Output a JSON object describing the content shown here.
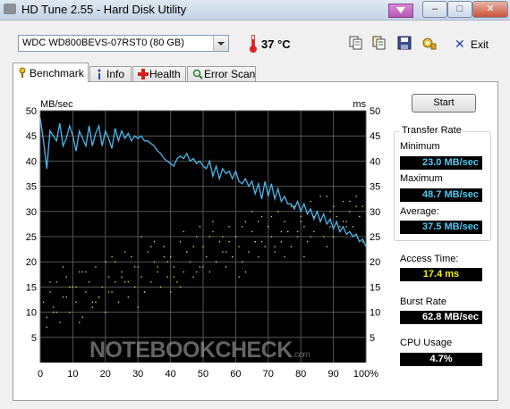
{
  "window": {
    "title": "HD Tune 2.55 - Hard Disk Utility",
    "minimize_glyph": "–",
    "maximize_glyph": "□",
    "close_glyph": "✕"
  },
  "toolbar": {
    "drive": "WDC WD800BEVS-07RST0 (80 GB)",
    "temperature": "37 °C",
    "exit_label": "Exit",
    "buttons": [
      "copy-icon",
      "copy-text-icon",
      "save-icon",
      "options-icon"
    ]
  },
  "tabs": [
    {
      "label": "Benchmark",
      "icon": "benchmark-icon",
      "active": true
    },
    {
      "label": "Info",
      "icon": "info-icon",
      "active": false
    },
    {
      "label": "Health",
      "icon": "health-icon",
      "active": false
    },
    {
      "label": "Error Scan",
      "icon": "error-scan-icon",
      "active": false
    }
  ],
  "benchmark": {
    "start_label": "Start",
    "transfer_rate_title": "Transfer Rate",
    "minimum_label": "Minimum",
    "minimum_value": "23.0 MB/sec",
    "maximum_label": "Maximum",
    "maximum_value": "48.7 MB/sec",
    "average_label": "Average:",
    "average_value": "37.5 MB/sec",
    "access_time_label": "Access Time:",
    "access_time_value": "17.4 ms",
    "burst_rate_label": "Burst Rate",
    "burst_rate_value": "62.8 MB/sec",
    "cpu_usage_label": "CPU Usage",
    "cpu_usage_value": "4.7%"
  },
  "watermark": {
    "text": "NOTEBOOKCHECK",
    "suffix": ".com"
  },
  "colors": {
    "transfer_line": "#4ab8ef",
    "access_points": "#e8e84a",
    "grid": "#555555",
    "plot_bg": "#000000"
  },
  "chart_data": {
    "type": "line",
    "xlabel": "",
    "ylabel_left": "MB/sec",
    "ylabel_right": "ms",
    "xlim": [
      0,
      100
    ],
    "ylim_left": [
      0,
      50
    ],
    "ylim_right": [
      0,
      50
    ],
    "x_ticks": [
      "0",
      "10",
      "20",
      "30",
      "40",
      "50",
      "60",
      "70",
      "80",
      "90",
      "100%"
    ],
    "y_ticks": [
      "5",
      "10",
      "15",
      "20",
      "25",
      "30",
      "35",
      "40",
      "45",
      "50"
    ],
    "grid": true,
    "series": [
      {
        "role": "transfer rate",
        "unit": "MB/sec",
        "x": [
          0,
          1,
          2,
          3,
          4,
          5,
          6,
          7,
          8,
          9,
          10,
          11,
          12,
          13,
          14,
          15,
          16,
          17,
          18,
          19,
          20,
          21,
          22,
          23,
          24,
          25,
          26,
          27,
          28,
          29,
          30,
          31,
          32,
          33,
          34,
          35,
          36,
          37,
          38,
          39,
          40,
          41,
          42,
          43,
          44,
          45,
          46,
          47,
          48,
          49,
          50,
          51,
          52,
          53,
          54,
          55,
          56,
          57,
          58,
          59,
          60,
          61,
          62,
          63,
          64,
          65,
          66,
          67,
          68,
          69,
          70,
          71,
          72,
          73,
          74,
          75,
          76,
          77,
          78,
          79,
          80,
          81,
          82,
          83,
          84,
          85,
          86,
          87,
          88,
          89,
          90,
          91,
          92,
          93,
          94,
          95,
          96,
          97,
          98,
          99,
          100
        ],
        "y": [
          48.5,
          44,
          38.5,
          46,
          45,
          44,
          47.5,
          43,
          44.5,
          47,
          45,
          42,
          46,
          44.5,
          43,
          47,
          43,
          45.5,
          47,
          43,
          46,
          44.5,
          42.5,
          46.5,
          44,
          46,
          44.5,
          45.5,
          44,
          45,
          44.5,
          45,
          44,
          44,
          43.5,
          43,
          42,
          41.5,
          40.5,
          40,
          39.5,
          39,
          40.5,
          41,
          40.5,
          41.5,
          40,
          40.5,
          39.5,
          40,
          39,
          38.5,
          40,
          37,
          39,
          36.5,
          38.5,
          37.5,
          38,
          36.5,
          38,
          36,
          35.5,
          36.5,
          35,
          36,
          33.5,
          35.5,
          32.5,
          36,
          33,
          35.5,
          32.5,
          34.5,
          32,
          33,
          31.5,
          31.5,
          30.5,
          32,
          30,
          31.5,
          29.5,
          30.5,
          28.5,
          30,
          28,
          29.5,
          27.5,
          28.5,
          26.5,
          28,
          26,
          27,
          25.5,
          26,
          25,
          25.5,
          24,
          24.5,
          23
        ]
      },
      {
        "role": "access time",
        "unit": "ms",
        "type": "scatter",
        "x": [
          1,
          2,
          3,
          4,
          5,
          6,
          7,
          8,
          9,
          10,
          11,
          12,
          13,
          14,
          15,
          16,
          17,
          18,
          19,
          20,
          21,
          22,
          23,
          24,
          25,
          26,
          27,
          28,
          29,
          30,
          31,
          32,
          33,
          34,
          35,
          36,
          37,
          38,
          39,
          40,
          41,
          42,
          43,
          44,
          45,
          46,
          47,
          48,
          49,
          50,
          51,
          52,
          53,
          54,
          55,
          56,
          57,
          58,
          59,
          60,
          61,
          62,
          63,
          64,
          65,
          66,
          67,
          68,
          69,
          70,
          71,
          72,
          73,
          74,
          75,
          76,
          77,
          78,
          79,
          80,
          81,
          82,
          83,
          84,
          85,
          86,
          87,
          88,
          89,
          90,
          91,
          92,
          93,
          94,
          95,
          96,
          97,
          98,
          99,
          2,
          5,
          8,
          11,
          14,
          17,
          20,
          23,
          26,
          29,
          32,
          35,
          38,
          41,
          44,
          47,
          50,
          53,
          56,
          59,
          62,
          65,
          68,
          71,
          74,
          77,
          80,
          83,
          86,
          89,
          92,
          95,
          98,
          3,
          7,
          12,
          16,
          21,
          25,
          30,
          34,
          39,
          43,
          48,
          52,
          57,
          61,
          66,
          70,
          75,
          79,
          84,
          88,
          93,
          97,
          4,
          9,
          13,
          18,
          22,
          27,
          31,
          36,
          40,
          45,
          49,
          54,
          58,
          63,
          67,
          72,
          76,
          81,
          85,
          90,
          94,
          99
        ],
        "y": [
          12,
          9,
          14,
          11,
          16,
          8,
          13,
          17,
          10,
          15,
          12,
          18,
          9,
          14,
          16,
          11,
          19,
          13,
          15,
          10,
          17,
          14,
          20,
          12,
          18,
          16,
          13,
          21,
          15,
          19,
          17,
          14,
          22,
          16,
          20,
          18,
          15,
          23,
          17,
          21,
          19,
          16,
          24,
          18,
          22,
          20,
          17,
          25,
          19,
          23,
          21,
          18,
          26,
          20,
          24,
          22,
          19,
          27,
          21,
          25,
          23,
          20,
          28,
          22,
          26,
          24,
          21,
          29,
          23,
          27,
          25,
          22,
          30,
          24,
          28,
          26,
          23,
          31,
          25,
          29,
          27,
          24,
          32,
          26,
          30,
          28,
          25,
          33,
          27,
          31,
          29,
          26,
          32,
          28,
          30,
          27,
          33,
          29,
          31,
          7,
          10,
          13,
          15,
          18,
          12,
          20,
          16,
          22,
          19,
          14,
          24,
          21,
          17,
          26,
          23,
          19,
          28,
          25,
          21,
          27,
          30,
          24,
          29,
          26,
          31,
          28,
          25,
          33,
          30,
          27,
          32,
          29,
          16,
          19,
          8,
          12,
          14,
          17,
          11,
          23,
          20,
          15,
          18,
          25,
          22,
          17,
          24,
          27,
          21,
          26,
          29,
          23,
          28,
          31,
          10,
          15,
          18,
          13,
          21,
          16,
          25,
          19,
          14,
          22,
          27,
          20,
          24,
          18,
          28,
          23,
          26,
          21,
          30,
          25,
          27,
          24
        ]
      }
    ]
  }
}
